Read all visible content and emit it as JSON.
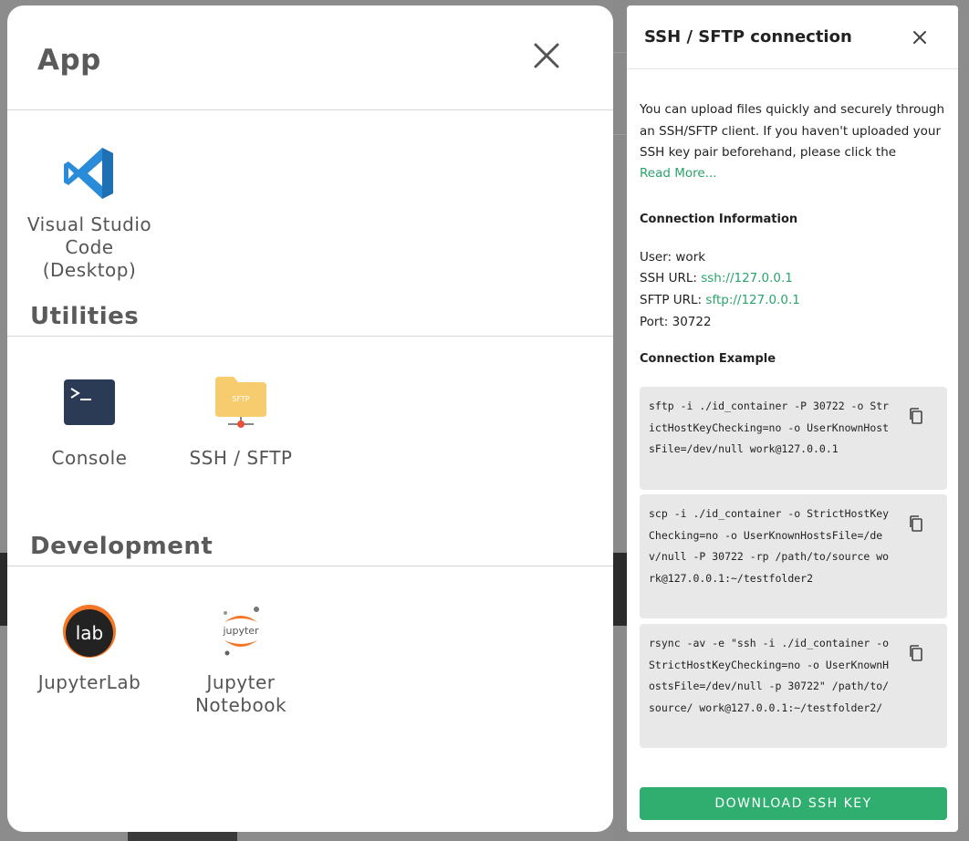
{
  "app_modal": {
    "title": "App",
    "apps": [
      {
        "label": "Visual Studio Code (Desktop)"
      }
    ],
    "utilities": {
      "title": "Utilities",
      "items": [
        {
          "label": "Console"
        },
        {
          "label": "SSH / SFTP",
          "icon_text": "SFTP"
        }
      ]
    },
    "development": {
      "title": "Development",
      "items": [
        {
          "label": "JupyterLab",
          "icon_text": "lab"
        },
        {
          "label": "Jupyter Notebook",
          "icon_text": "jupyter"
        }
      ]
    }
  },
  "ssh_panel": {
    "title": "SSH / SFTP connection",
    "description": "You can upload files quickly and securely through an SSH/SFTP client. If you haven't uploaded your SSH key pair beforehand, please click the",
    "read_more": "Read More...",
    "connection_info_title": "Connection Information",
    "user_label": "User:",
    "user_value": "work",
    "ssh_url_label": "SSH URL:",
    "ssh_url_value": "ssh://127.0.0.1",
    "sftp_url_label": "SFTP URL:",
    "sftp_url_value": "sftp://127.0.0.1",
    "port_label": "Port:",
    "port_value": "30722",
    "example_title": "Connection Example",
    "examples": [
      "sftp -i ./id_container -P 30722 -o StrictHostKeyChecking=no -o UserKnownHostsFile=/dev/null work@127.0.0.1",
      "scp -i ./id_container -o StrictHostKeyChecking=no -o UserKnownHostsFile=/dev/null -P 30722 -rp /path/to/source work@127.0.0.1:~/testfolder2",
      "rsync -av -e \"ssh -i ./id_container -o StrictHostKeyChecking=no -o UserKnownHostsFile=/dev/null -p 30722\" /path/to/source/ work@127.0.0.1:~/testfolder2/"
    ],
    "download_label": "DOWNLOAD SSH KEY"
  },
  "colors": {
    "accent_green": "#2fae6f",
    "link_green": "#2aa36b",
    "vscode_blue": "#2a8cd8",
    "console_bg": "#2b3a55",
    "folder_yellow": "#f6cc6e",
    "jupyter_orange": "#f37726"
  }
}
